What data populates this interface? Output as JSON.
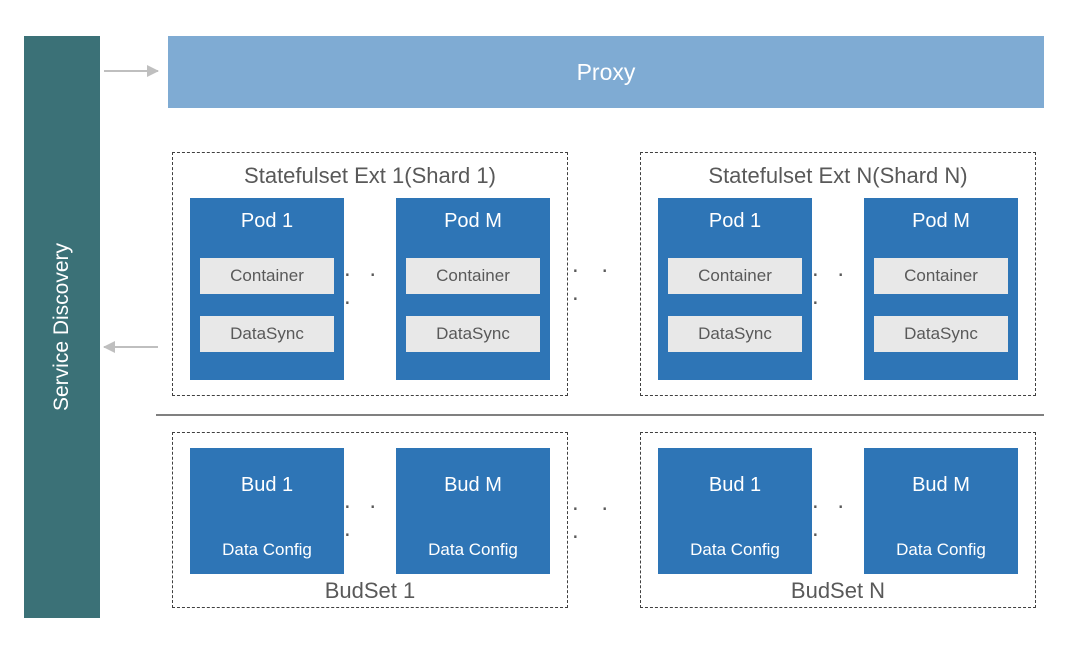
{
  "sidebar": {
    "label": "Service Discovery"
  },
  "proxy": {
    "label": "Proxy"
  },
  "shards": {
    "left": {
      "title": "Statefulset Ext 1(Shard 1)"
    },
    "right": {
      "title": "Statefulset Ext N(Shard N)"
    }
  },
  "pods": {
    "pod1": {
      "title": "Pod 1",
      "container": "Container",
      "datasync": "DataSync"
    },
    "podM": {
      "title": "Pod M",
      "container": "Container",
      "datasync": "DataSync"
    },
    "pod1_r": {
      "title": "Pod 1",
      "container": "Container",
      "datasync": "DataSync"
    },
    "podM_r": {
      "title": "Pod M",
      "container": "Container",
      "datasync": "DataSync"
    }
  },
  "buds": {
    "b1": {
      "title": "Bud 1",
      "sub": "Data Config"
    },
    "bM": {
      "title": "Bud M",
      "sub": "Data Config"
    },
    "b1_r": {
      "title": "Bud 1",
      "sub": "Data Config"
    },
    "bM_r": {
      "title": "Bud M",
      "sub": "Data Config"
    }
  },
  "budsets": {
    "left": "BudSet 1",
    "right": "BudSet N"
  },
  "ellipsis": ". . ."
}
